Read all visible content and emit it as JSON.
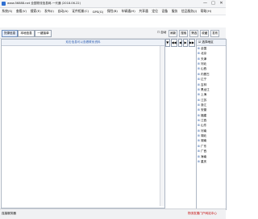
{
  "window": {
    "title": "www.56888.net 全国物流信息网-一代通 (2018.06.22)",
    "controls": [
      "—",
      "□",
      "✕"
    ]
  },
  "menu": [
    "系统(S)",
    "查看(V)",
    "搜索(E)",
    "发布(I)",
    "自动(A)",
    "证件相册(C)",
    "GPS(G)",
    "保险(B)",
    "车辆通(H)",
    "共享通",
    "定位",
    "设备",
    "服务",
    "信品服务(J)",
    "帮助(H)"
  ],
  "toolbar": {
    "buttons": [
      "货源信息",
      "本地信息",
      "一键接单"
    ],
    "checkbox_label": "自动",
    "right_buttons": [
      "刷新",
      "搜索",
      "筛选",
      "收藏",
      "发布"
    ]
  },
  "list_panel": {
    "header": "双击信息可以查看联系资料"
  },
  "nav_icons": [
    "▼",
    "◀◀",
    "◀",
    "▶",
    "▶▶"
  ],
  "region_panel": {
    "header": "☑ 选择地区",
    "items": [
      "全国",
      "北京",
      "天津",
      "河北",
      "山西",
      "内蒙古",
      "辽宁",
      "吉林",
      "黑龙江",
      "上海",
      "江苏",
      "浙江",
      "安徽",
      "福建",
      "江西",
      "山东",
      "河南",
      "湖北",
      "湖南",
      "广东",
      "广西",
      "海南",
      "重庆"
    ]
  },
  "status": {
    "left": "连接服务器",
    "right": "物流发展门户网站中心"
  },
  "colors": {
    "accent": "#2f6fd1",
    "header_text": "#2d5db0",
    "status_red": "#c00000"
  }
}
